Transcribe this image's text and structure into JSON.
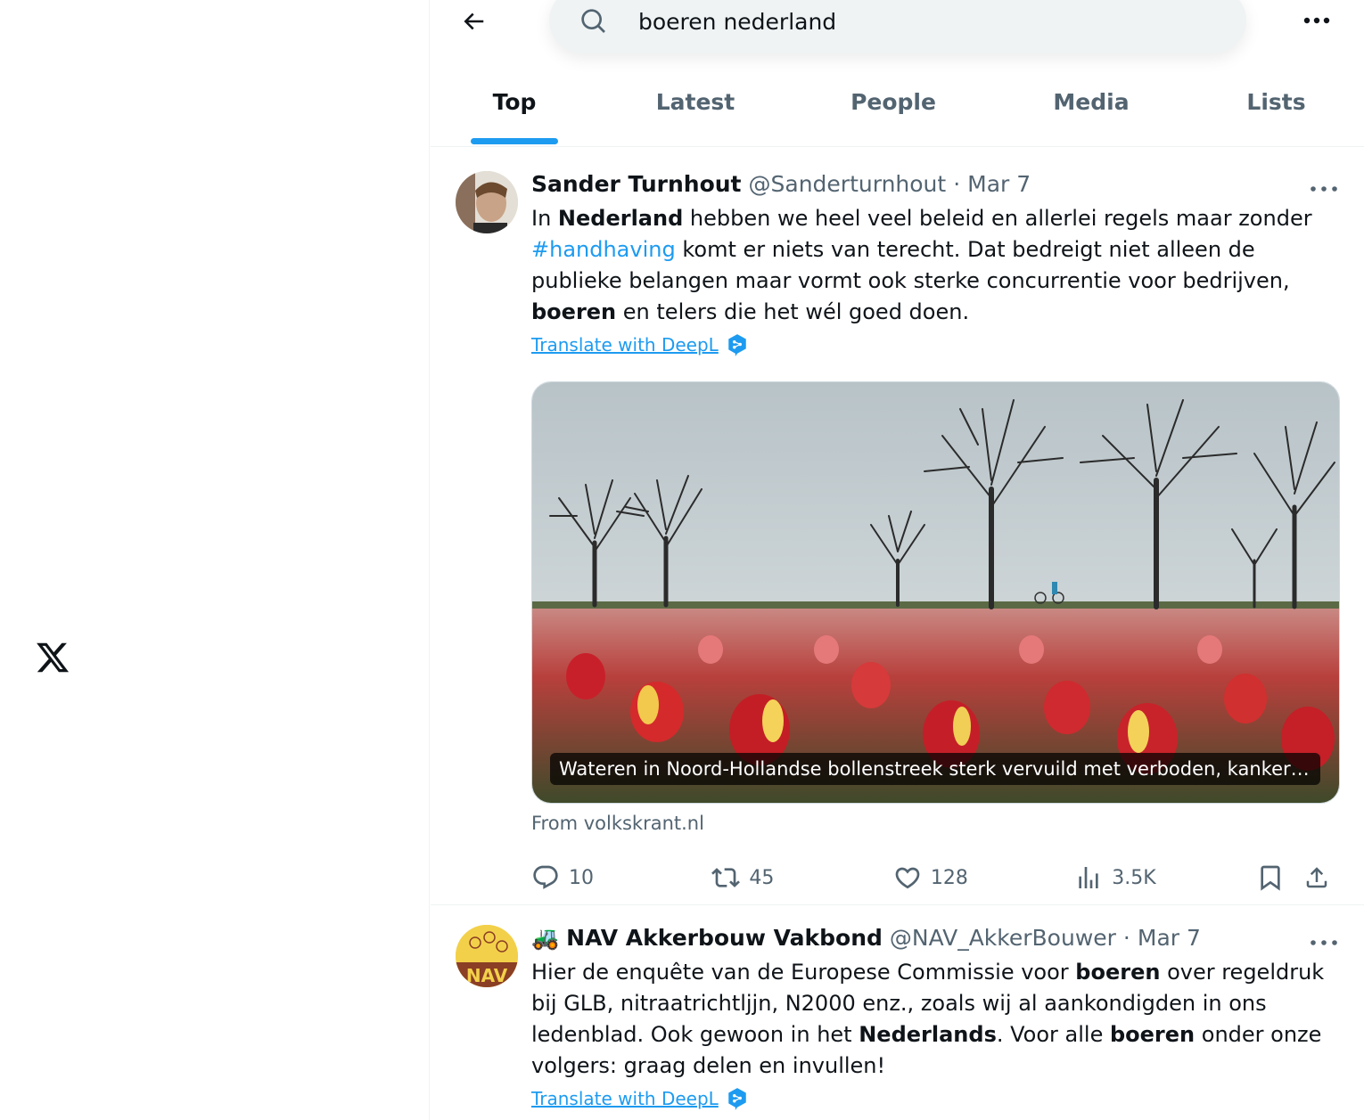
{
  "search": {
    "query": "boeren nederland"
  },
  "tabs": [
    {
      "label": "Top",
      "active": true
    },
    {
      "label": "Latest"
    },
    {
      "label": "People"
    },
    {
      "label": "Media"
    },
    {
      "label": "Lists"
    }
  ],
  "tweets": [
    {
      "name": "Sander Turnhout",
      "handle": "@Sanderturnhout",
      "separator": "·",
      "date": "Mar 7",
      "text_parts": [
        "In ",
        "Nederland",
        " hebben we heel veel beleid en allerlei regels maar zonder ",
        "#handhaving",
        " komt er niets van terecht. Dat bedreigt niet alleen de publieke belangen maar vormt ook sterke concurrentie voor bedrijven, ",
        "boeren",
        " en telers die het wél goed doen."
      ],
      "translate": "Translate with DeepL",
      "card_caption": "Wateren in Noord-Hollandse bollenstreek sterk vervuild met verboden, kankerverwekkende middelen",
      "from": "From volkskrant.nl",
      "stats": {
        "replies": "10",
        "reposts": "45",
        "likes": "128",
        "views": "3.5K"
      }
    },
    {
      "name_emoji": "🚜",
      "name": "NAV Akkerbouw Vakbond",
      "handle": "@NAV_AkkerBouwer",
      "separator": "·",
      "date": "Mar 7",
      "avatar_text": "NAV",
      "text_parts": [
        "Hier de enquête van de Europese Commissie voor ",
        "boeren",
        " over regeldruk bij GLB, nitraatrichtljjn,  N2000 enz., zoals wij al aankondigden in ons ledenblad. Ook gewoon in het ",
        "Nederlands",
        ". Voor alle ",
        "boeren",
        " onder onze volgers: graag delen en invullen!"
      ],
      "translate": "Translate with DeepL"
    }
  ],
  "colors": {
    "accent": "#1d9bf0",
    "secondary_text": "#536471",
    "border": "#eff3f4"
  }
}
